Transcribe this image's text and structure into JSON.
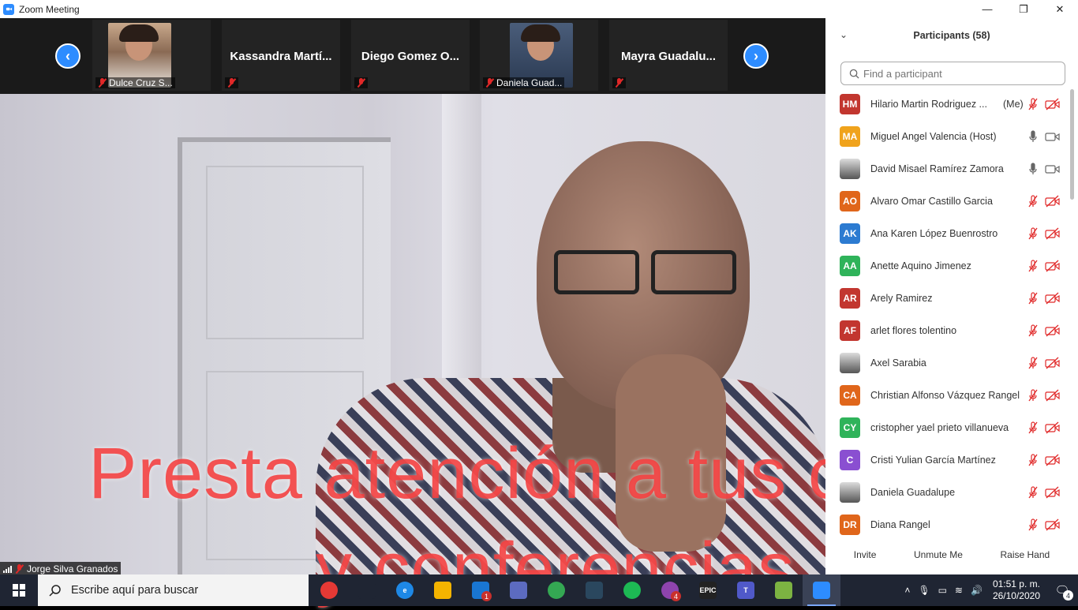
{
  "window": {
    "title": "Zoom Meeting",
    "controls": [
      "minimize-icon",
      "restore-icon",
      "close-icon"
    ]
  },
  "gallery": {
    "thumbnails": [
      {
        "name": "Dulce Cruz S...",
        "has_video": true
      },
      {
        "name": "Kassandra  Martí...",
        "has_video": false
      },
      {
        "name": "Diego  Gomez  O...",
        "has_video": false
      },
      {
        "name": "Daniela Guad...",
        "has_video": true
      },
      {
        "name": "Mayra  Guadalu...",
        "has_video": false
      }
    ]
  },
  "speaker": {
    "name": "Jorge Silva Granados"
  },
  "overlay": {
    "line1": "Presta atención a tus clases",
    "line2": "y conferencias"
  },
  "participants": {
    "title": "Participants (58)",
    "search_placeholder": "Find a participant",
    "list": [
      {
        "initials": "HM",
        "color": "#c2362f",
        "name": "Hilario Martin Rodriguez ...",
        "tag": "(Me)",
        "mic": "off",
        "cam": "off"
      },
      {
        "initials": "MA",
        "color": "#f0a31c",
        "name": "Miguel Angel Valencia (Host)",
        "tag": "",
        "mic": "on",
        "cam": "on"
      },
      {
        "initials": "",
        "color": "photo",
        "name": "David Misael Ramírez Zamora",
        "tag": "",
        "mic": "on",
        "cam": "on"
      },
      {
        "initials": "AO",
        "color": "#e0661b",
        "name": "Alvaro Omar Castillo Garcia",
        "tag": "",
        "mic": "off",
        "cam": "off"
      },
      {
        "initials": "AK",
        "color": "#2c7bd1",
        "name": "Ana Karen López Buenrostro",
        "tag": "",
        "mic": "off",
        "cam": "off"
      },
      {
        "initials": "AA",
        "color": "#2fb35a",
        "name": "Anette Aquino Jimenez",
        "tag": "",
        "mic": "off",
        "cam": "off"
      },
      {
        "initials": "AR",
        "color": "#c2362f",
        "name": "Arely Ramirez",
        "tag": "",
        "mic": "off",
        "cam": "off"
      },
      {
        "initials": "AF",
        "color": "#c2362f",
        "name": "arlet flores tolentino",
        "tag": "",
        "mic": "off",
        "cam": "off"
      },
      {
        "initials": "",
        "color": "photo",
        "name": "Axel Sarabia",
        "tag": "",
        "mic": "off",
        "cam": "off"
      },
      {
        "initials": "CA",
        "color": "#e0661b",
        "name": "Christian Alfonso Vázquez Rangel",
        "tag": "",
        "mic": "off",
        "cam": "off"
      },
      {
        "initials": "CY",
        "color": "#2fb35a",
        "name": "cristopher yael prieto villanueva",
        "tag": "",
        "mic": "off",
        "cam": "off"
      },
      {
        "initials": "C",
        "color": "#8a4fd1",
        "name": "Cristi Yulian García Martínez",
        "tag": "",
        "mic": "off",
        "cam": "off"
      },
      {
        "initials": "",
        "color": "photo",
        "name": "Daniela Guadalupe",
        "tag": "",
        "mic": "off",
        "cam": "off"
      },
      {
        "initials": "DR",
        "color": "#e0661b",
        "name": "Diana Rangel",
        "tag": "",
        "mic": "off",
        "cam": "off"
      }
    ],
    "footer": {
      "invite": "Invite",
      "unmute": "Unmute Me",
      "raise_hand": "Raise Hand"
    }
  },
  "taskbar": {
    "search_placeholder": "Escribe aquí para buscar",
    "apps": [
      {
        "name": "cortana-icon",
        "label": "",
        "color": "#e53935"
      },
      {
        "name": "task-view-icon",
        "label": "",
        "color": "#1f2533"
      },
      {
        "name": "edge-icon",
        "label": "e",
        "color": "#1e88e5"
      },
      {
        "name": "file-explorer-icon",
        "label": "",
        "color": "#f4b400"
      },
      {
        "name": "mail-icon",
        "label": "",
        "color": "#1976d2",
        "badge": "1"
      },
      {
        "name": "store-icon",
        "label": "",
        "color": "#5c6bc0"
      },
      {
        "name": "chrome-icon",
        "label": "",
        "color": "#34a853"
      },
      {
        "name": "steam-icon",
        "label": "",
        "color": "#2a475e"
      },
      {
        "name": "spotify-icon",
        "label": "",
        "color": "#1db954"
      },
      {
        "name": "messenger-icon",
        "label": "",
        "color": "#8e44ad",
        "badge": "4"
      },
      {
        "name": "epic-games-icon",
        "label": "EPIC",
        "color": "#222"
      },
      {
        "name": "teams-icon",
        "label": "T",
        "color": "#5059c9"
      },
      {
        "name": "android-icon",
        "label": "",
        "color": "#7cb342"
      },
      {
        "name": "zoom-icon",
        "label": "",
        "color": "#2d8cff",
        "active": true
      }
    ],
    "clock_time": "01:51 p. m.",
    "clock_date": "26/10/2020",
    "notifications": "4"
  }
}
